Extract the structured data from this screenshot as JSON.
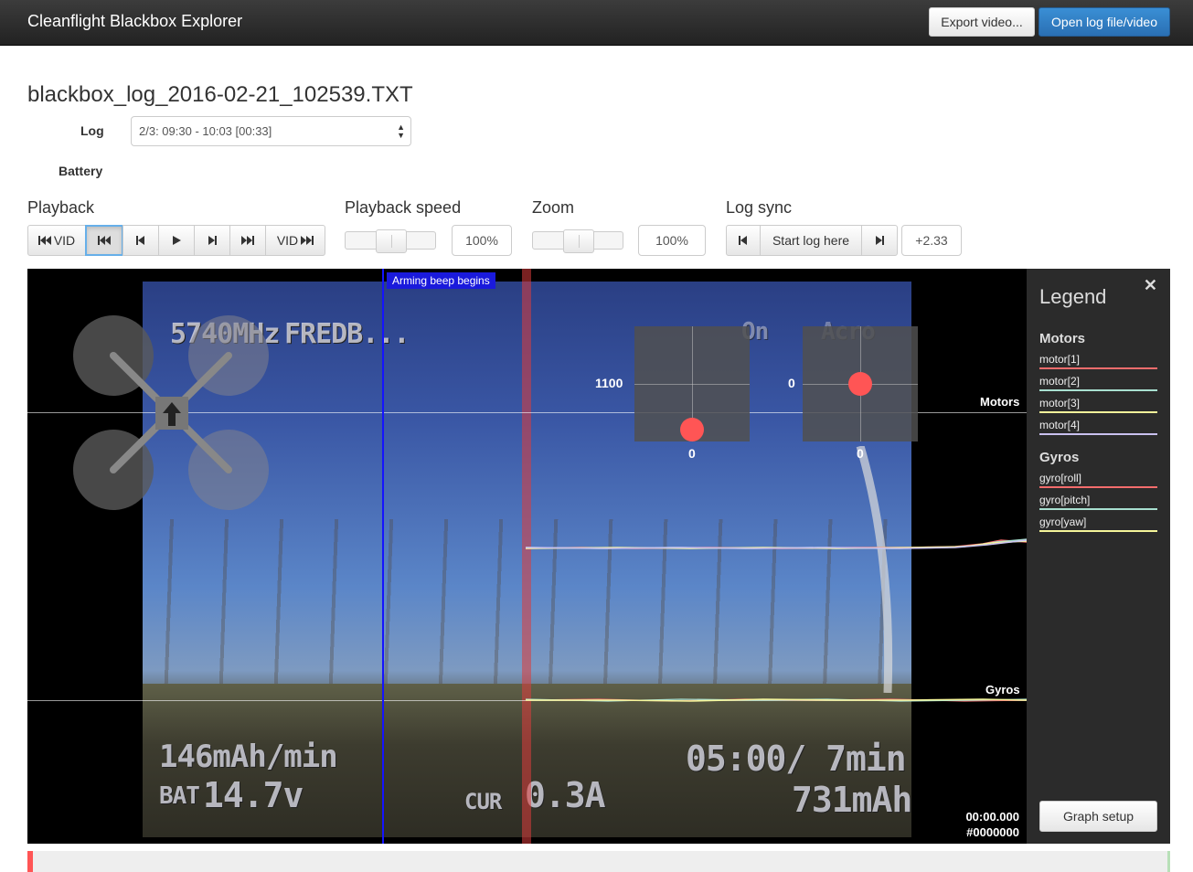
{
  "app": {
    "title": "Cleanflight Blackbox Explorer"
  },
  "nav": {
    "export_label": "Export video...",
    "open_label": "Open log file/video"
  },
  "log": {
    "filename": "blackbox_log_2016-02-21_102539.TXT",
    "log_label": "Log",
    "selected": "2/3: 09:30 - 10:03 [00:33]",
    "battery_label": "Battery"
  },
  "playback": {
    "label": "Playback",
    "buttons": {
      "vid_start": "VID",
      "vid_end": "VID"
    }
  },
  "speed": {
    "label": "Playback speed",
    "value": "100%",
    "level": 0.5
  },
  "zoom": {
    "label": "Zoom",
    "value": "100%",
    "level": 0.5
  },
  "sync": {
    "label": "Log sync",
    "start_label": "Start log here",
    "offset": "+2.33"
  },
  "graph": {
    "marker": "Arming beep begins",
    "motors_label": "Motors",
    "gyros_label": "Gyros",
    "stick_left": {
      "left_value": "1100",
      "bottom_value": "0"
    },
    "stick_right": {
      "left_value": "0",
      "bottom_value": "0"
    },
    "time": "00:00.000",
    "frame": "#0000000",
    "osd": {
      "freq": "5740MHz",
      "pilot": "FREDB...",
      "mode_on": "On",
      "mode": "Acro",
      "current_rate": "146mAh/min",
      "bat": "BAT",
      "voltage": "14.7v",
      "cur": "CUR",
      "current": "0.3A",
      "timer": "05:00/ 7min",
      "used": "731mAh"
    }
  },
  "legend": {
    "title": "Legend",
    "groups": [
      {
        "name": "Motors",
        "items": [
          {
            "name": "motor[1]",
            "color": "#f36c6c"
          },
          {
            "name": "motor[2]",
            "color": "#a8e0d0"
          },
          {
            "name": "motor[3]",
            "color": "#f5f59a"
          },
          {
            "name": "motor[4]",
            "color": "#c9c1f0"
          }
        ]
      },
      {
        "name": "Gyros",
        "items": [
          {
            "name": "gyro[roll]",
            "color": "#f36c6c"
          },
          {
            "name": "gyro[pitch]",
            "color": "#a8e0d0"
          },
          {
            "name": "gyro[yaw]",
            "color": "#f5f59a"
          }
        ]
      }
    ],
    "setup_label": "Graph setup"
  },
  "colors": {
    "accent": "#2a6fb3",
    "cursor": "#1414ff",
    "stick_dot": "#ff5555"
  }
}
